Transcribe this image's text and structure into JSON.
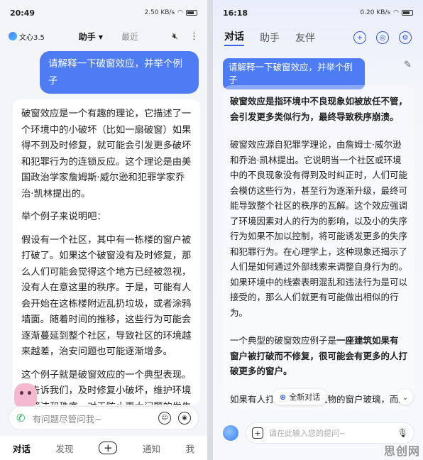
{
  "left": {
    "status": {
      "time": "20:49",
      "signal": "2.50 KB/s"
    },
    "header": {
      "logo_text": "文心3.5",
      "tabs": [
        "助手",
        "最近"
      ],
      "active_tab": "助手"
    },
    "question": "请解释一下破窗效应，并举个例子",
    "answer": {
      "p1": "破窗效应是一个有趣的理论，它描述了一个环境中的小破坏（比如一扇破窗）如果得不到及时修复，就可能会引发更多破坏和犯罪行为的连锁反应。这个理论是由美国政治学家詹姆斯·威尔逊和犯罪学家乔治·凯林提出的。",
      "p2": "举个例子来说明吧：",
      "p3": "假设有一个社区，其中有一栋楼的窗户被打破了。如果这个破窗没有及时修复，那么人们可能会觉得这个地方已经被忽视，没有人在意这里的秩序。于是，可能有人会开始在这栋楼附近乱扔垃圾，或者涂鸦墙面。随着时间的推移，这些行为可能会逐渐蔓延到整个社区，导致社区的环境越来越差，治安问题也可能逐渐增多。",
      "p4": "这个例子就是破窗效应的一个典型表现。它告诉我们，及时修复小破坏，维护环境的整洁和秩序，对于防止更大问题的发生非常重要。"
    },
    "input_placeholder": "有问题尽管问我~",
    "nav": [
      "对话",
      "发现",
      "+",
      "通知",
      "我"
    ],
    "nav_active": "对话"
  },
  "right": {
    "status": {
      "time": "16:18",
      "signal": "0.20 KB/s"
    },
    "header": {
      "tabs": [
        "对话",
        "助手",
        "友伴"
      ],
      "active_tab": "对话"
    },
    "question": "请解释一下破窗效应，并举个例子",
    "answer": {
      "p1_bold": "破窗效应是指环境中不良现象如被放任不管，会引发更多类似行为，最终导致秩序崩溃。",
      "p2": "破窗效应源自犯罪学理论，由詹姆士·威尔逊和乔治·凯林提出。它说明当一个社区或环境中的不良现象没有得到及时纠正时，人们可能会模仿这些行为，甚至行为逐渐升级，最终可能导致整个社区的秩序的瓦解。这个效应强调了环境因素对人的行为的影响，以及小的失序行为如果不加以控制，将可能诱发更多的失序和犯罪行为。在心理学上，这种现象还揭示了人们是如何通过外部线索来调整自身行为的。如果环境中的线索表明混乱和违法行为是可以接受的，那么人们就更有可能做出相似的行为。",
      "p3_lead": "一个典型的破窗效应例子是",
      "p3_bold": "一座建筑如果有窗户被打破而不修复，很可能会有更多的人打破更多的窗户。",
      "p4": "如果有人打坏了一幢建筑物的窗户玻璃，而这扇窗户又得不到及时的维修，别人就可能受到某些示范性的纵容去打烂更多的窗户。"
    },
    "float_button": "全新对话",
    "input_placeholder": "请在此输入您的提问~"
  },
  "watermark": "思创网",
  "colors": {
    "accent": "#4d7cf5",
    "brand_blue": "#3763e8"
  }
}
